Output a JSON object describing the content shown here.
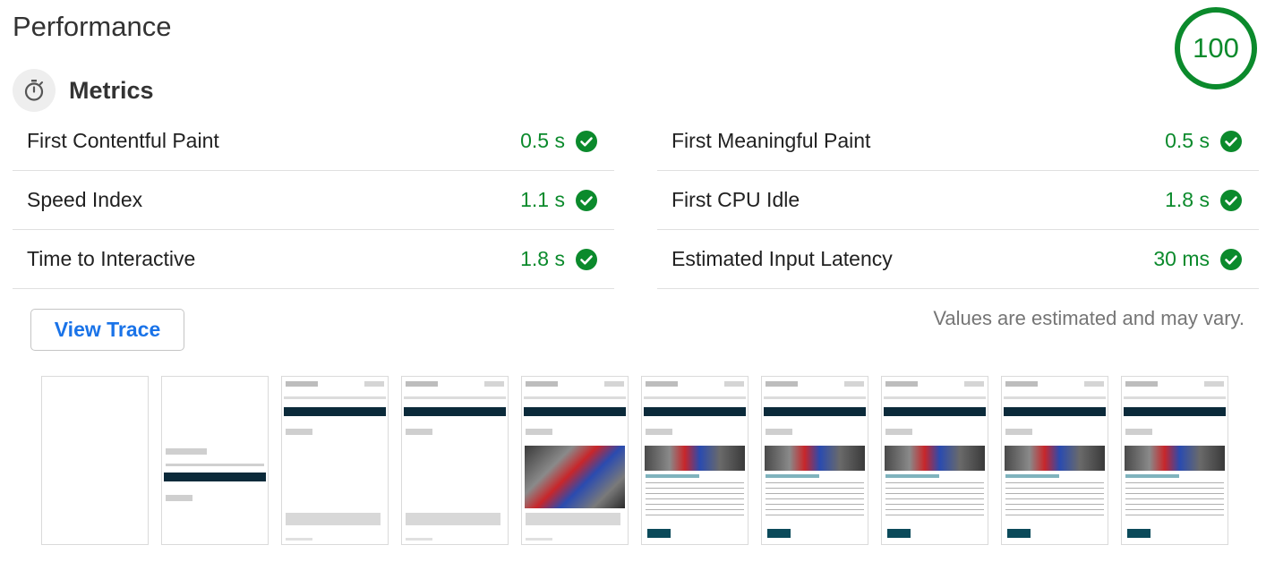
{
  "header": {
    "title": "Performance",
    "score": "100",
    "score_color": "#0b8a2c"
  },
  "metrics": {
    "section_title": "Metrics",
    "section_icon": "stopwatch-icon",
    "left": [
      {
        "name": "First Contentful Paint",
        "value": "0.5 s"
      },
      {
        "name": "Speed Index",
        "value": "1.1 s"
      },
      {
        "name": "Time to Interactive",
        "value": "1.8 s"
      }
    ],
    "right": [
      {
        "name": "First Meaningful Paint",
        "value": "0.5 s"
      },
      {
        "name": "First CPU Idle",
        "value": "1.8 s"
      },
      {
        "name": "Estimated Input Latency",
        "value": "30 ms"
      }
    ],
    "pass_icon": "check-circle-icon",
    "pass_color": "#0b8a2c"
  },
  "actions": {
    "view_trace_label": "View Trace",
    "estimate_note": "Values are estimated and may vary."
  },
  "filmstrip": {
    "frame_count": 10
  }
}
